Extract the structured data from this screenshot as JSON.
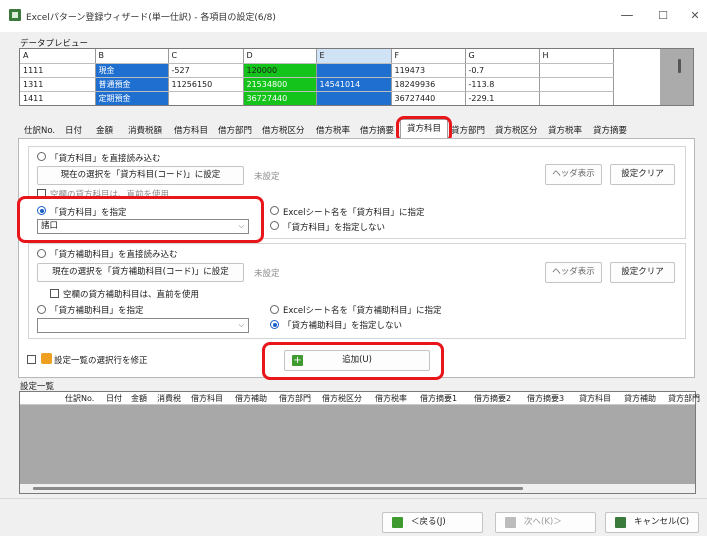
{
  "window": {
    "title": "Excelパターン登録ウィザード(単一仕訳) - 各項目の設定(6/8)",
    "minimize": "—",
    "maximize": "☐",
    "close": "✕"
  },
  "preview": {
    "label": "データプレビュー",
    "columns": [
      "A",
      "B",
      "C",
      "D",
      "E",
      "F",
      "G",
      "H"
    ],
    "rows": [
      [
        "1111",
        "現金",
        "-527",
        "120000",
        "",
        "119473",
        "-0.7",
        ""
      ],
      [
        "1311",
        "普通預金",
        "11256150",
        "21534800",
        "14541014",
        "18249936",
        "-113.8",
        ""
      ],
      [
        "1411",
        "定期預金",
        "",
        "36727440",
        "",
        "36727440",
        "-229.1",
        ""
      ]
    ],
    "colors": {
      "blue": "#1f6fd1",
      "green": "#15c41b",
      "selected_header": "#cfe2f6"
    }
  },
  "tabs": {
    "items": [
      "仕訳No.",
      "日付",
      "金額",
      "消費税額",
      "借方科目",
      "借方部門",
      "借方税区分",
      "借方税率",
      "借方摘要",
      "貸方科目",
      "貸方部門",
      "貸方税区分",
      "貸方税率",
      "貸方摘要"
    ],
    "active": "貸方科目"
  },
  "account": {
    "read_direct_label": "「貸方科目」を直接読み込む",
    "select_code_button": "現在の選択を「貸方科目(コード)」に設定",
    "unset_text": "未設定",
    "header_button": "ヘッダ表示",
    "clear_button": "設定クリア",
    "blank_prev_label": "空欄の貸方科目は、直前を使用",
    "specify_label": "「貸方科目」を指定",
    "specify_value": "諸口",
    "sheet_name_label": "Excelシート名を「貸方科目」に指定",
    "no_specify_label": "「貸方科目」を指定しない"
  },
  "sub_account": {
    "read_direct_label": "「貸方補助科目」を直接読み込む",
    "select_code_button": "現在の選択を「貸方補助科目(コード)」に設定",
    "unset_text": "未設定",
    "header_button": "ヘッダ表示",
    "clear_button": "設定クリア",
    "blank_prev_label": "空欄の貸方補助科目は、直前を使用",
    "specify_label": "「貸方補助科目」を指定",
    "specify_value": "",
    "sheet_name_label": "Excelシート名を「貸方補助科目」に指定",
    "no_specify_label": "「貸方補助科目」を指定しない"
  },
  "fix_selection_label": "設定一覧の選択行を修正",
  "add_button": "追加(U)",
  "settings_list": {
    "label": "設定一覧",
    "columns": [
      "仕訳No.",
      "日付",
      "金額",
      "消費税",
      "借方科目",
      "借方補助",
      "借方部門",
      "借方税区分",
      "借方税率",
      "借方摘要1",
      "借方摘要2",
      "借方摘要3",
      "貸方科目",
      "貸方補助",
      "貸方部門"
    ]
  },
  "footer": {
    "back_button": "＜戻る(J)",
    "next_button": "次へ(K)＞",
    "cancel_button": "キャンセル(C)"
  },
  "accent": {
    "highlight_red": "#e8151b",
    "add_icon_green": "#3f9b2f"
  }
}
